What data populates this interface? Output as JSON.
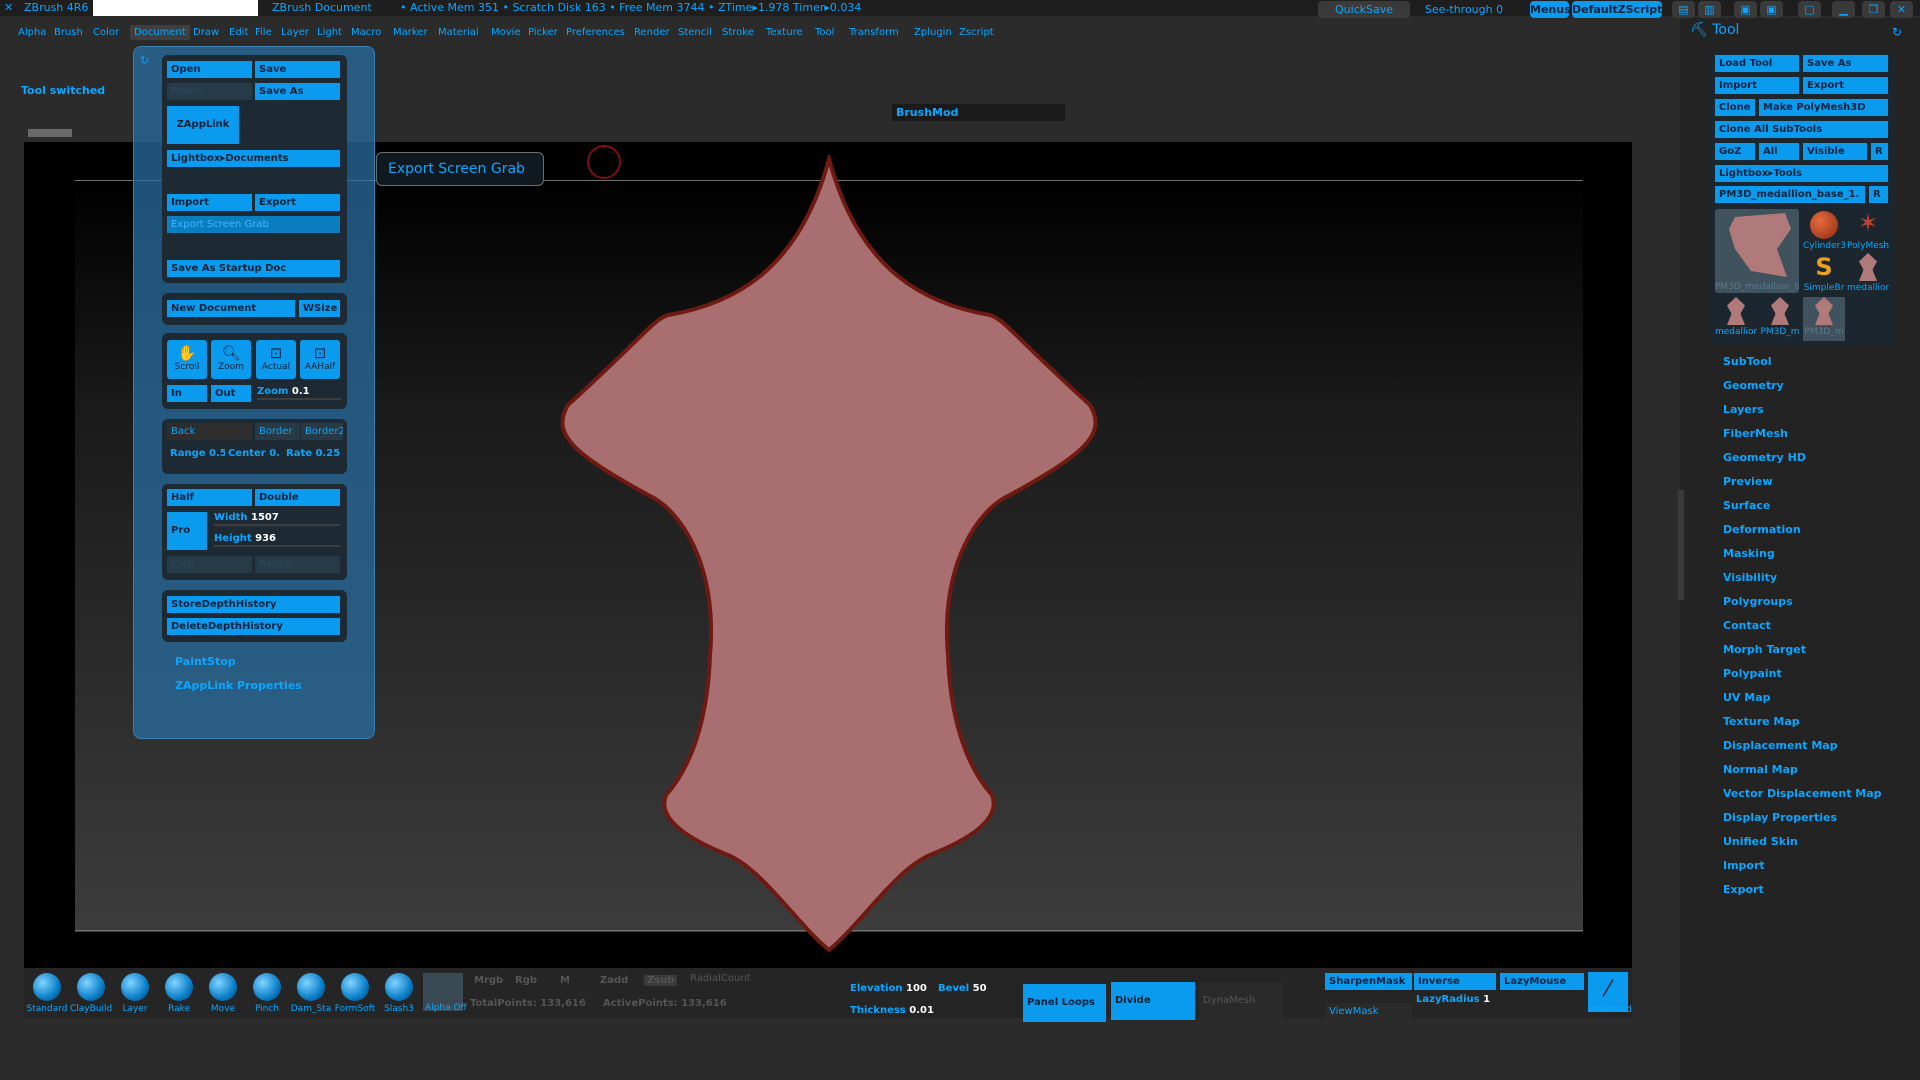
{
  "titlebar": {
    "app": "ZBrush 4R6",
    "document": "ZBrush Document",
    "stats": "• Active Mem 351 • Scratch Disk 163 • Free Mem 3744 • ZTime▸1.978 Timer▸0.034",
    "quicksave": "QuickSave",
    "seethrough": "See-through",
    "seethrough_value": "0",
    "menus": "Menus",
    "zscript": "DefaultZScript"
  },
  "menubar": [
    "Alpha",
    "Brush",
    "Color",
    "Document",
    "Draw",
    "Edit",
    "File",
    "Layer",
    "Light",
    "Macro",
    "Marker",
    "Material",
    "Movie",
    "Picker",
    "Preferences",
    "Render",
    "Stencil",
    "Stroke",
    "Texture",
    "Tool",
    "Transform",
    "Zplugin",
    "Zscript"
  ],
  "notification": "Tool switched",
  "brushmod": "BrushMod",
  "tooltip": "Export Screen Grab",
  "document_menu": {
    "open": "Open",
    "save": "Save",
    "revert": "Revert",
    "save_as": "Save As",
    "zapplink": "ZAppLink",
    "lightbox": "Lightbox▸Documents",
    "import": "Import",
    "export": "Export",
    "export_screen_grab": "Export Screen Grab",
    "save_startup": "Save As Startup Doc",
    "new_document": "New Document",
    "wsize": "WSize",
    "scroll": "Scroll",
    "zoom": "Zoom",
    "actual": "Actual",
    "aahalf": "AAHalf",
    "in": "In",
    "out": "Out",
    "zoom_label": "Zoom",
    "zoom_value": "0.1",
    "back": "Back",
    "border": "Border",
    "border2": "Border2",
    "range": "Range 0.5",
    "center": "Center 0.",
    "rate": "Rate 0.25",
    "half": "Half",
    "double": "Double",
    "pro": "Pro",
    "width_label": "Width",
    "width_value": "1507",
    "height_label": "Height",
    "height_value": "936",
    "crop": "Crop",
    "resize": "Resize",
    "store_depth": "StoreDepthHistory",
    "delete_depth": "DeleteDepthHistory",
    "paintstop": "PaintStop",
    "zapplink_props": "ZAppLink Properties"
  },
  "tool_panel": {
    "header": "Tool",
    "load_tool": "Load Tool",
    "save_as": "Save As",
    "import": "Import",
    "export": "Export",
    "clone": "Clone",
    "make_polymesh": "Make PolyMesh3D",
    "clone_all": "Clone All SubTools",
    "goz": "GoZ",
    "all": "All",
    "visible": "Visible",
    "r": "R",
    "lightbox_tools": "Lightbox▸Tools",
    "current_tool": "PM3D_medallion_base_1.",
    "thumbs": [
      "PM3D_medallion_b",
      "Cylinder3",
      "PolyMesh",
      "SimpleBr",
      "medallion",
      "medallion",
      "PM3D_m",
      "PM3D_m"
    ],
    "sections": [
      "SubTool",
      "Geometry",
      "Layers",
      "FiberMesh",
      "Geometry HD",
      "Preview",
      "Surface",
      "Deformation",
      "Masking",
      "Visibility",
      "Polygroups",
      "Contact",
      "Morph Target",
      "Polypaint",
      "UV Map",
      "Texture Map",
      "Displacement Map",
      "Normal Map",
      "Vector Displacement Map",
      "Display Properties",
      "Unified Skin",
      "Import",
      "Export"
    ]
  },
  "shelf": {
    "brushes": [
      "Standard",
      "ClayBuild",
      "Layer",
      "Rake",
      "Move",
      "Pinch",
      "Dam_Sta",
      "FormSoft",
      "Slash3",
      "Alpha Off"
    ],
    "mrgb": [
      "Mrgb",
      "Rgb",
      "M",
      "Zadd",
      "Zsub"
    ],
    "radialcount": "RadialCount",
    "totalpoints": "TotalPoints: 133,616",
    "activepoints": "ActivePoints: 133,616",
    "elevation_label": "Elevation",
    "elevation_value": "100",
    "bevel_label": "Bevel",
    "bevel_value": "50",
    "thickness_label": "Thickness",
    "thickness_value": "0.01",
    "panel_loops": "Panel Loops",
    "divide": "Divide",
    "dynamesh": "DynaMesh",
    "sharpenmask": "SharpenMask",
    "inverse": "Inverse",
    "lazymouse": "LazyMouse",
    "viewmask": "ViewMask",
    "lazyradius_label": "LazyRadius",
    "lazyradius_value": "1",
    "freehand": "FreeHand"
  },
  "colors": {
    "accent": "#0aa6ff",
    "button": "#0a9aee",
    "shape_fill": "#a86e70",
    "shape_stroke": "#6e1a12"
  }
}
